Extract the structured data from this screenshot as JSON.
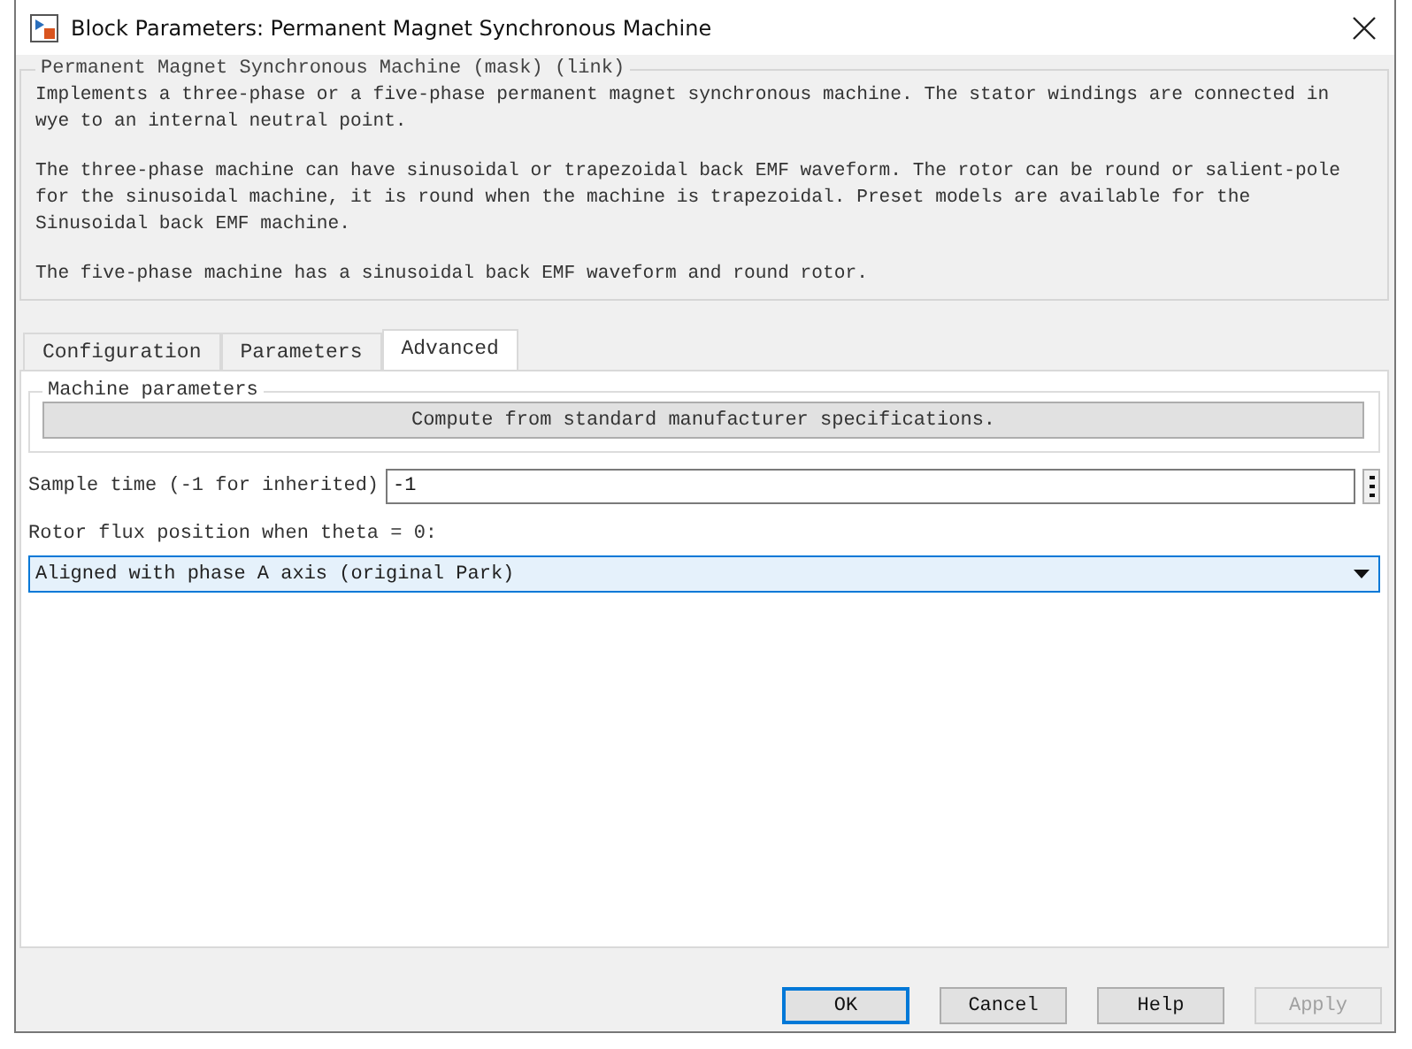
{
  "window": {
    "title": "Block Parameters: Permanent Magnet Synchronous Machine"
  },
  "description": {
    "legend": "Permanent Magnet Synchronous Machine (mask) (link)",
    "paragraphs": [
      "Implements a three-phase or a five-phase permanent magnet synchronous machine. The stator windings are connected in wye to an internal neutral point.",
      "The three-phase machine can have sinusoidal or trapezoidal back EMF waveform. The rotor can be round or salient-pole for the sinusoidal machine, it is round when the machine is trapezoidal. Preset models are available for the Sinusoidal back EMF machine.",
      "The five-phase machine has a sinusoidal back EMF waveform and round rotor."
    ]
  },
  "tabs": [
    {
      "label": "Configuration",
      "selected": false
    },
    {
      "label": "Parameters",
      "selected": false
    },
    {
      "label": "Advanced",
      "selected": true
    }
  ],
  "machine_parameters": {
    "legend": "Machine parameters",
    "button": "Compute from standard manufacturer specifications."
  },
  "sample_time": {
    "label": "Sample time (-1 for inherited)",
    "value": "-1"
  },
  "rotor_flux": {
    "label": "Rotor flux position when theta = 0:",
    "value": "Aligned with phase A axis (original Park)"
  },
  "buttons": [
    {
      "label": "OK",
      "disabled": false,
      "default": true
    },
    {
      "label": "Cancel",
      "disabled": false,
      "default": false
    },
    {
      "label": "Help",
      "disabled": false,
      "default": false
    },
    {
      "label": "Apply",
      "disabled": true,
      "default": false
    }
  ]
}
